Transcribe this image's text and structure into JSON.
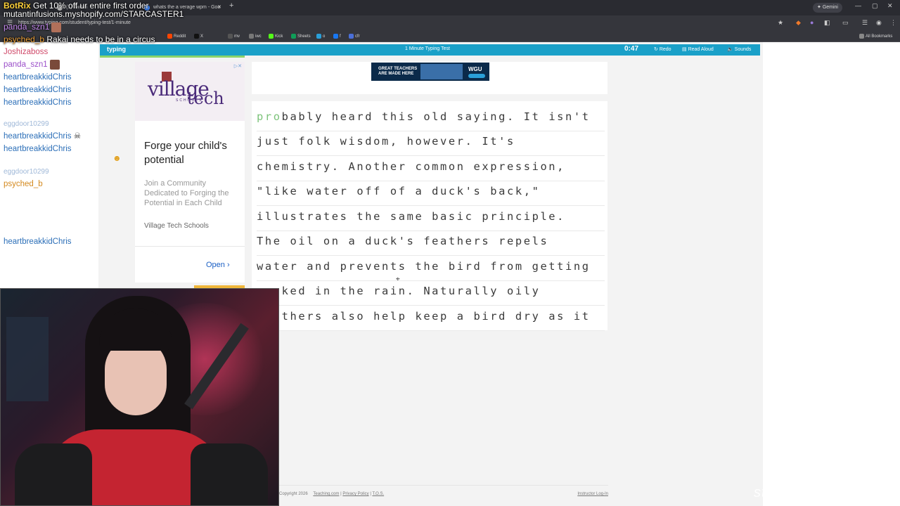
{
  "browser": {
    "tabs": [
      {
        "label": "(1) Twitch"
      },
      {
        "label": "Typing Test"
      },
      {
        "label": "whats the a verage wpm - Goo"
      }
    ],
    "url": "https://www.typing.com/student/typing-test/1-minute",
    "gemini_label": "Gemini",
    "bookmarks": [
      "Reddit",
      "X",
      "mv",
      "iwc",
      "Kick",
      "Sheets",
      "o",
      "f",
      "cfr"
    ],
    "all_bookmarks": "All Bookmarks"
  },
  "site": {
    "logo": "typing",
    "page_title": "1 Minute Typing Test",
    "timer": "0:47",
    "nav": {
      "redo": "Redo",
      "read_aloud": "Read Aloud",
      "sounds": "Sounds"
    }
  },
  "ad_left": {
    "logo_main": "village",
    "logo_tech": "tech",
    "logo_sub": "SCHOOLS",
    "headline": "Forge your child's potential",
    "subtext": "Join a Community Dedicated to Forging the Potential in Each Child",
    "brand": "Village Tech Schools",
    "open_label": "Open"
  },
  "ad_banner": {
    "text": "GREAT TEACHERS ARE MADE HERE",
    "brand": "WGU"
  },
  "typing": {
    "first_typed": "pro",
    "first_rest": "bably heard this old saying. It isn't",
    "lines": [
      "just folk wisdom, however. It's",
      "chemistry. Another common expression,",
      "\"like water off of a duck's back,\"",
      "illustrates the same basic principle.",
      "The oil on a duck's feathers repels",
      "water and prevents the bird from getting",
      "soaked in the rain. Naturally oily",
      "feathers also help keep a bird dry as it"
    ]
  },
  "footer": {
    "copyright": "Copyright 2026",
    "links": [
      "Teaching.com",
      "Privacy Policy",
      "T.O.S."
    ],
    "instructor": "Instructor Log-In"
  },
  "chat": {
    "top1_user": "BotRix",
    "top1_msg": "Get 10% off ur entire first order",
    "top1_msg2": "mutantinfusions.myshopify.com/STARCASTER1",
    "top2_user": "panda_szn1",
    "top3_user": "psyched_b",
    "top3_msg": "Rakai needs to be in a circus",
    "users": [
      {
        "name": "Joshizaboss",
        "color": "#d04a6a"
      },
      {
        "name": "panda_szn1",
        "color": "#9b4fc9"
      },
      {
        "name": "heartbreakkidChris",
        "color": "#2c6fb8"
      },
      {
        "name": "heartbreakkidChris",
        "color": "#2c6fb8"
      },
      {
        "name": "heartbreakkidChris",
        "color": "#2c6fb8"
      },
      {
        "name": "eggdoor10299",
        "color": "#9fb8d8"
      },
      {
        "name": "heartbreakkidChris",
        "color": "#2c6fb8"
      },
      {
        "name": "heartbreakkidChris",
        "color": "#2c6fb8"
      },
      {
        "name": "eggdoor10299",
        "color": "#9fb8d8"
      },
      {
        "name": "psyched_b",
        "color": "#d4891e"
      },
      {
        "name": "heartbreakkidChris",
        "color": "#2c6fb8"
      }
    ]
  },
  "watermark": "starcaster1"
}
